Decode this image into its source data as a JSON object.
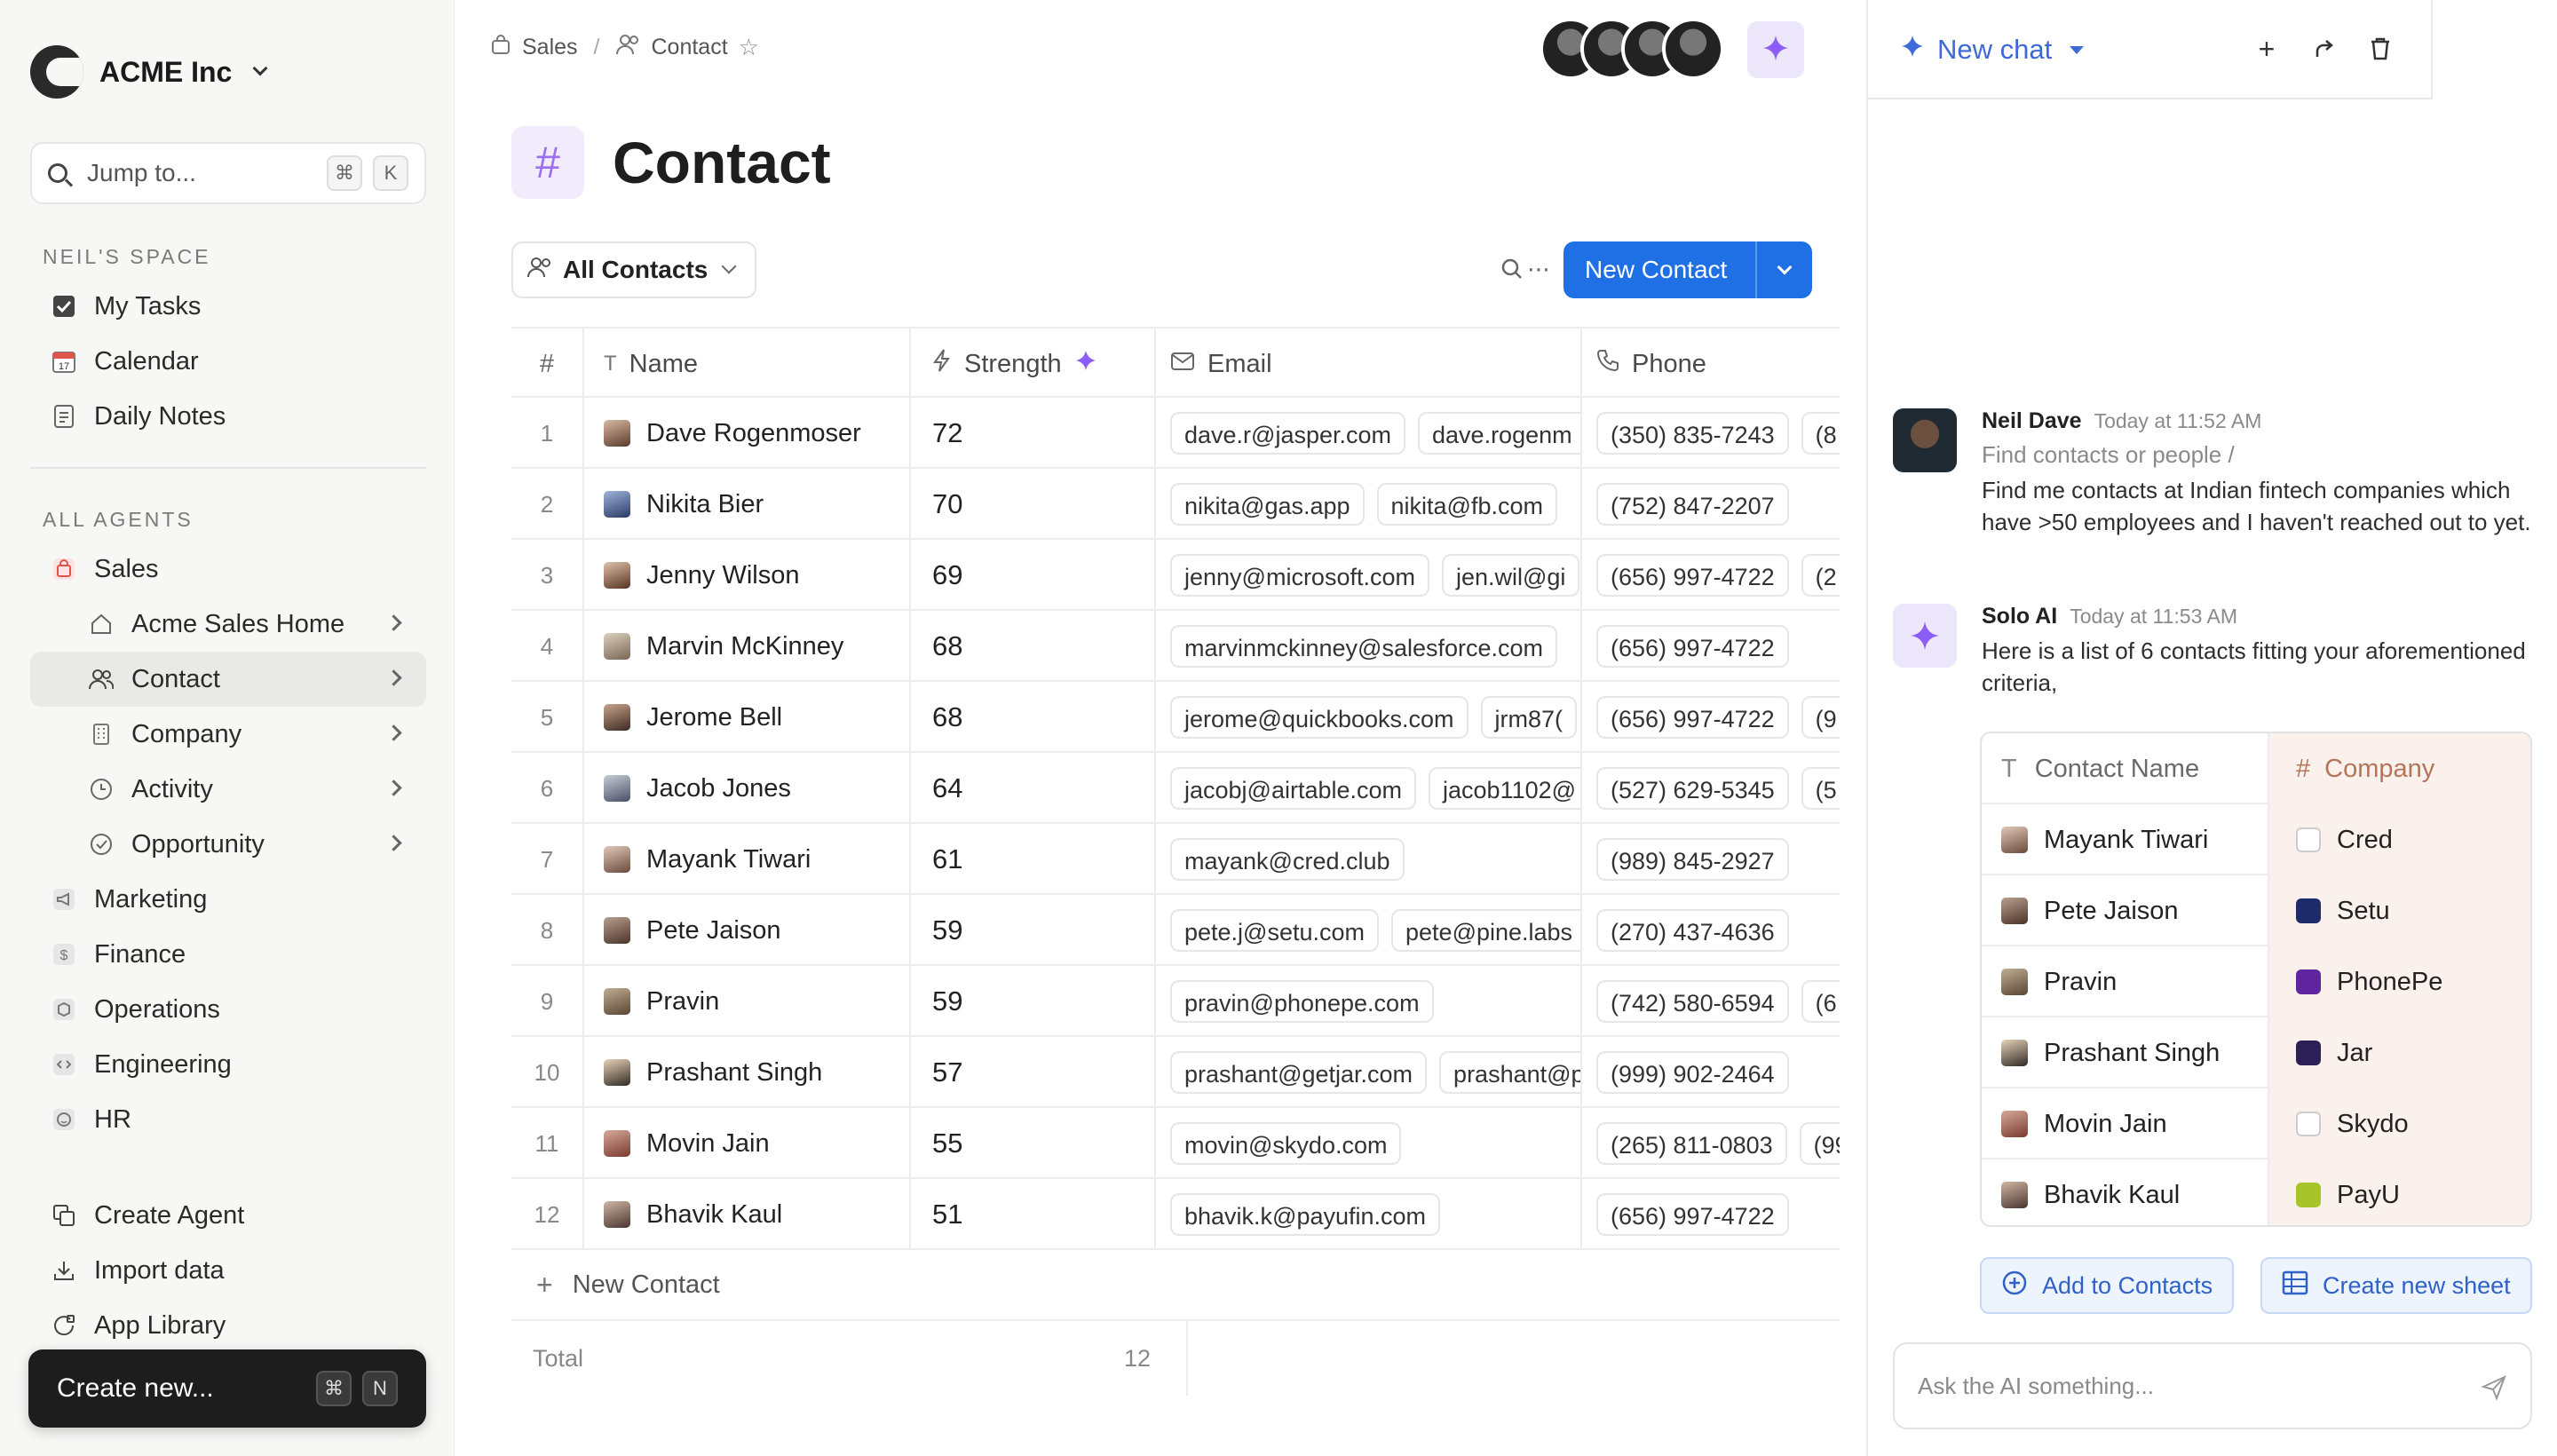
{
  "colors": {
    "accent": "#1f6fe5",
    "ai_purple": "#9b6ff0",
    "chat_blue": "#3f68d8",
    "sidebar_bg": "#f7f7f6",
    "company_col_bg": "#fbf1ec"
  },
  "sidebar": {
    "org_name": "ACME Inc",
    "jump_placeholder": "Jump to...",
    "jump_kbd": [
      "⌘",
      "K"
    ],
    "space_label": "NEIL'S SPACE",
    "space_items": [
      {
        "label": "My Tasks",
        "icon": "checkbox-icon"
      },
      {
        "label": "Calendar",
        "icon": "calendar-icon"
      },
      {
        "label": "Daily Notes",
        "icon": "note-icon"
      }
    ],
    "agents_label": "ALL AGENTS",
    "agents": [
      {
        "label": "Sales",
        "icon": "bag-icon"
      },
      {
        "label": "Acme Sales Home",
        "icon": "home-icon"
      },
      {
        "label": "Contact",
        "icon": "people-icon"
      },
      {
        "label": "Company",
        "icon": "building-icon"
      },
      {
        "label": "Activity",
        "icon": "clock-icon"
      },
      {
        "label": "Opportunity",
        "icon": "check-circle-icon"
      },
      {
        "label": "Marketing",
        "icon": "megaphone-icon"
      },
      {
        "label": "Finance",
        "icon": "dollar-icon"
      },
      {
        "label": "Operations",
        "icon": "box-icon"
      },
      {
        "label": "Engineering",
        "icon": "code-icon"
      },
      {
        "label": "HR",
        "icon": "smile-icon"
      }
    ],
    "footer_items": [
      {
        "label": "Create Agent",
        "icon": "copy-icon"
      },
      {
        "label": "Import data",
        "icon": "download-icon"
      },
      {
        "label": "App Library",
        "icon": "app-icon"
      }
    ],
    "create_new_label": "Create new...",
    "create_new_kbd": [
      "⌘",
      "N"
    ]
  },
  "main": {
    "breadcrumb": [
      "Sales",
      "Contact"
    ],
    "title": "Contact",
    "view_label": "All Contacts",
    "new_button_label": "New Contact",
    "columns": {
      "num": "#",
      "name": "Name",
      "strength": "Strength",
      "email": "Email",
      "phone": "Phone"
    },
    "rows": [
      {
        "num": "1",
        "name": "Dave Rogenmoser",
        "strength": "72",
        "emails": [
          "dave.r@jasper.com",
          "dave.rogenm"
        ],
        "phones": [
          "(350) 835-7243",
          "(8"
        ]
      },
      {
        "num": "2",
        "name": "Nikita Bier",
        "strength": "70",
        "emails": [
          "nikita@gas.app",
          "nikita@fb.com"
        ],
        "phones": [
          "(752) 847-2207"
        ]
      },
      {
        "num": "3",
        "name": "Jenny Wilson",
        "strength": "69",
        "emails": [
          "jenny@microsoft.com",
          "jen.wil@gi"
        ],
        "phones": [
          "(656) 997-4722",
          "(2"
        ]
      },
      {
        "num": "4",
        "name": "Marvin McKinney",
        "strength": "68",
        "emails": [
          "marvinmckinney@salesforce.com"
        ],
        "phones": [
          "(656) 997-4722"
        ]
      },
      {
        "num": "5",
        "name": "Jerome Bell",
        "strength": "68",
        "emails": [
          "jerome@quickbooks.com",
          "jrm87("
        ],
        "phones": [
          "(656) 997-4722",
          "(9"
        ]
      },
      {
        "num": "6",
        "name": "Jacob Jones",
        "strength": "64",
        "emails": [
          "jacobj@airtable.com",
          "jacob1102@"
        ],
        "phones": [
          "(527) 629-5345",
          "(5"
        ]
      },
      {
        "num": "7",
        "name": "Mayank Tiwari",
        "strength": "61",
        "emails": [
          "mayank@cred.club"
        ],
        "phones": [
          "(989) 845-2927"
        ]
      },
      {
        "num": "8",
        "name": "Pete Jaison",
        "strength": "59",
        "emails": [
          "pete.j@setu.com",
          "pete@pine.labs"
        ],
        "phones": [
          "(270) 437-4636"
        ]
      },
      {
        "num": "9",
        "name": "Pravin",
        "strength": "59",
        "emails": [
          "pravin@phonepe.com"
        ],
        "phones": [
          "(742) 580-6594",
          "(6"
        ]
      },
      {
        "num": "10",
        "name": "Prashant Singh",
        "strength": "57",
        "emails": [
          "prashant@getjar.com",
          "prashant@p"
        ],
        "phones": [
          "(999) 902-2464"
        ]
      },
      {
        "num": "11",
        "name": "Movin Jain",
        "strength": "55",
        "emails": [
          "movin@skydo.com"
        ],
        "phones": [
          "(265) 811-0803",
          "(99"
        ]
      },
      {
        "num": "12",
        "name": "Bhavik Kaul",
        "strength": "51",
        "emails": [
          "bhavik.k@payufin.com"
        ],
        "phones": [
          "(656) 997-4722"
        ]
      }
    ],
    "new_row_label": "New Contact",
    "total_label": "Total",
    "total_value": "12"
  },
  "chat": {
    "title": "New chat",
    "user_msg": {
      "author": "Neil Dave",
      "time": "Today at 11:52 AM",
      "command": "Find contacts or people /",
      "text": "Find me contacts at Indian fintech companies which have >50 employees and I haven't reached out to yet."
    },
    "ai_msg": {
      "author": "Solo AI",
      "time": "Today at 11:53 AM",
      "text": "Here is a list of 6 contacts fitting your aforementioned criteria,"
    },
    "result_columns": {
      "name": "Contact Name",
      "company": "Company"
    },
    "results": [
      {
        "name": "Mayank Tiwari",
        "company": "Cred",
        "logo_color": "#ffffff"
      },
      {
        "name": "Pete Jaison",
        "company": "Setu",
        "logo_color": "#1d2b6b"
      },
      {
        "name": "Pravin",
        "company": "PhonePe",
        "logo_color": "#5f259f"
      },
      {
        "name": "Prashant Singh",
        "company": "Jar",
        "logo_color": "#2b1f55"
      },
      {
        "name": "Movin Jain",
        "company": "Skydo",
        "logo_color": "#ffffff"
      },
      {
        "name": "Bhavik Kaul",
        "company": "PayU",
        "logo_color": "#a6c42a"
      }
    ],
    "add_button": "Add to Contacts",
    "sheet_button": "Create new sheet",
    "input_placeholder": "Ask the AI something..."
  }
}
